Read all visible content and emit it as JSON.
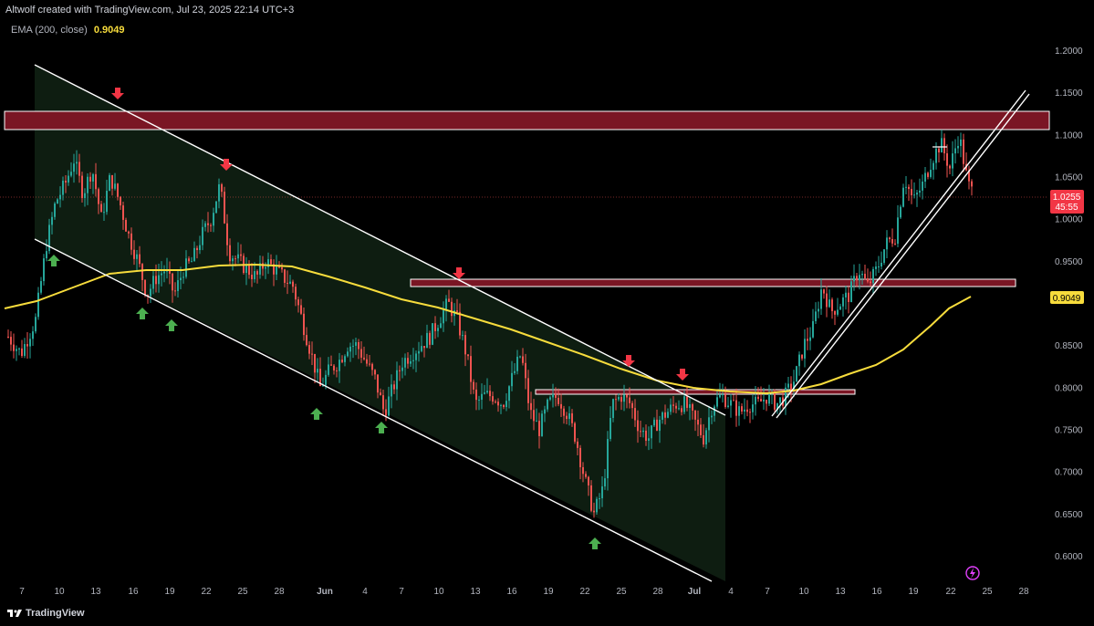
{
  "header": {
    "title": "Altwolf created with TradingView.com, Jul 23, 2025 22:14 UTC+3"
  },
  "indicator": {
    "name": "EMA (200, close)",
    "value": "0.9049",
    "color": "#f7dc3c"
  },
  "footer": {
    "brand": "TradingView"
  },
  "colors": {
    "background": "#000000",
    "bull": "#26a69a",
    "bear": "#ef5350",
    "ema": "#f7dc3c",
    "resistance_zone": "#8b1a2a",
    "channel_fill": "#0f1f12",
    "arrow_up": "#4caf50",
    "arrow_down": "#f23645"
  },
  "price_axis": {
    "ticks": [
      "1.2000",
      "1.1500",
      "1.1000",
      "1.0500",
      "1.0000",
      "0.9500",
      "0.9049",
      "0.8500",
      "0.8000",
      "0.7500",
      "0.7000",
      "0.6500",
      "0.6000"
    ],
    "current_price": "1.0255",
    "countdown": "45:55",
    "ema_label": "0.9049"
  },
  "time_axis": {
    "ticks": [
      "7",
      "10",
      "13",
      "16",
      "19",
      "22",
      "25",
      "28",
      "Jun",
      "4",
      "7",
      "10",
      "13",
      "16",
      "19",
      "22",
      "25",
      "28",
      "Jul",
      "4",
      "7",
      "10",
      "13",
      "16",
      "19",
      "22",
      "25",
      "28"
    ]
  },
  "annotations": {
    "resistance_zone_top": [
      1.1275,
      1.105
    ],
    "middle_zone": [
      0.9265,
      0.9175
    ],
    "lower_zone": [
      0.793,
      0.787
    ]
  }
}
